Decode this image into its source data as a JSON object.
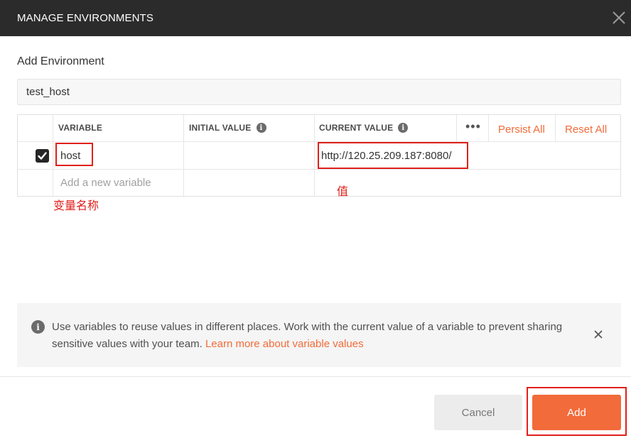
{
  "window": {
    "title": "MANAGE ENVIRONMENTS",
    "close_icon": "close-icon"
  },
  "form": {
    "section_label": "Add Environment",
    "environment_name": "test_host"
  },
  "table": {
    "headers": {
      "variable": "VARIABLE",
      "initial_value": "INITIAL VALUE",
      "current_value": "CURRENT VALUE",
      "info_glyph": "i",
      "more_glyph": "•••"
    },
    "actions": {
      "persist_all": "Persist All",
      "reset_all": "Reset All"
    },
    "rows": [
      {
        "checked": true,
        "variable": "host",
        "initial_value": "",
        "current_value": "http://120.25.209.187:8080/"
      }
    ],
    "new_row_placeholder": "Add a new variable"
  },
  "annotations": {
    "variable_name_note": "变量名称",
    "value_note": "值",
    "color": "#e0201b"
  },
  "info_banner": {
    "icon_glyph": "i",
    "text": "Use variables to reuse values in different places. Work with the current value of a variable to prevent sharing sensitive values with your team.",
    "link_text": "Learn more about variable values"
  },
  "footer": {
    "cancel_label": "Cancel",
    "add_label": "Add"
  },
  "colors": {
    "accent": "#f26b3a",
    "titlebar": "#2b2b2b"
  }
}
